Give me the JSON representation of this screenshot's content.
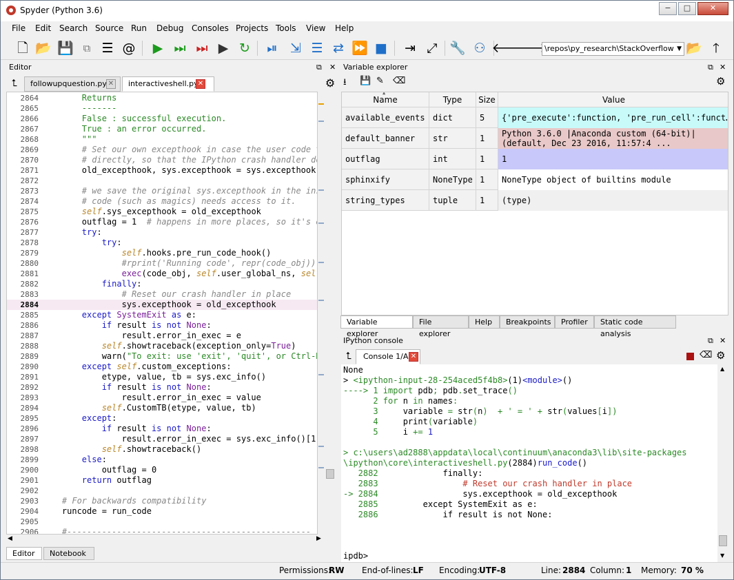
{
  "window": {
    "title": "Spyder (Python 3.6)",
    "min": "−",
    "max": "□",
    "close": "✕"
  },
  "menu": [
    "File",
    "Edit",
    "Search",
    "Source",
    "Run",
    "Debug",
    "Consoles",
    "Projects",
    "Tools",
    "View",
    "Help"
  ],
  "toolbar": {
    "path": "\\repos\\py_research\\StackOverflow",
    "dropdown": "▼"
  },
  "editor": {
    "title": "Editor",
    "tabs": [
      {
        "label": "followupquestion.py*"
      },
      {
        "label": "interactiveshell.py"
      }
    ],
    "bottom_tabs": [
      "Editor",
      "Notebook"
    ],
    "lines": [
      {
        "n": "2864",
        "segs": [
          {
            "t": "        "
          },
          {
            "t": "Returns",
            "c": "s"
          }
        ]
      },
      {
        "n": "2865",
        "segs": [
          {
            "t": "        "
          },
          {
            "t": "-------",
            "c": "s"
          }
        ]
      },
      {
        "n": "2866",
        "segs": [
          {
            "t": "        "
          },
          {
            "t": "False : successful execution.",
            "c": "s"
          }
        ]
      },
      {
        "n": "2867",
        "segs": [
          {
            "t": "        "
          },
          {
            "t": "True : an error occurred.",
            "c": "s"
          }
        ]
      },
      {
        "n": "2868",
        "segs": [
          {
            "t": "        "
          },
          {
            "t": "\"\"\"",
            "c": "s"
          }
        ]
      },
      {
        "n": "2869",
        "segs": [
          {
            "t": "        "
          },
          {
            "t": "# Set our own excepthook in case the user code tr",
            "c": "c"
          }
        ]
      },
      {
        "n": "2870",
        "segs": [
          {
            "t": "        "
          },
          {
            "t": "# directly, so that the IPython crash handler doe",
            "c": "c"
          }
        ]
      },
      {
        "n": "2871",
        "segs": [
          {
            "t": "        old_excepthook, sys.excepthook = sys.excepthook,"
          }
        ]
      },
      {
        "n": "2872",
        "segs": []
      },
      {
        "n": "2873",
        "segs": [
          {
            "t": "        "
          },
          {
            "t": "# we save the original sys.excepthook in the inst",
            "c": "c"
          }
        ]
      },
      {
        "n": "2874",
        "segs": [
          {
            "t": "        "
          },
          {
            "t": "# code (such as magics) needs access to it.",
            "c": "c"
          }
        ]
      },
      {
        "n": "2875",
        "segs": [
          {
            "t": "        "
          },
          {
            "t": "self",
            "c": "n"
          },
          {
            "t": ".sys_excepthook = old_excepthook"
          }
        ]
      },
      {
        "n": "2876",
        "segs": [
          {
            "t": "        outflag = 1  "
          },
          {
            "t": "# happens in more places, so it's ea",
            "c": "c"
          }
        ]
      },
      {
        "n": "2877",
        "segs": [
          {
            "t": "        "
          },
          {
            "t": "try",
            "c": "k"
          },
          {
            "t": ":"
          }
        ]
      },
      {
        "n": "2878",
        "segs": [
          {
            "t": "            "
          },
          {
            "t": "try",
            "c": "k"
          },
          {
            "t": ":"
          }
        ]
      },
      {
        "n": "2879",
        "segs": [
          {
            "t": "                "
          },
          {
            "t": "self",
            "c": "n"
          },
          {
            "t": ".hooks.pre_run_code_hook()"
          }
        ]
      },
      {
        "n": "2880",
        "segs": [
          {
            "t": "                "
          },
          {
            "t": "#rprint('Running code', repr(code_obj)) #",
            "c": "c"
          }
        ]
      },
      {
        "n": "2881",
        "segs": [
          {
            "t": "                "
          },
          {
            "t": "exec",
            "c": "p"
          },
          {
            "t": "(code_obj, "
          },
          {
            "t": "self",
            "c": "n"
          },
          {
            "t": ".user_global_ns, "
          },
          {
            "t": "self",
            "c": "n"
          },
          {
            "t": "."
          }
        ]
      },
      {
        "n": "2882",
        "segs": [
          {
            "t": "            "
          },
          {
            "t": "finally",
            "c": "k"
          },
          {
            "t": ":"
          }
        ]
      },
      {
        "n": "2883",
        "segs": [
          {
            "t": "                "
          },
          {
            "t": "# Reset our crash handler in place",
            "c": "c"
          }
        ]
      },
      {
        "n": "2884",
        "cur": true,
        "segs": [
          {
            "t": "                sys.excepthook = old_excepthook"
          }
        ]
      },
      {
        "n": "2885",
        "segs": [
          {
            "t": "        "
          },
          {
            "t": "except",
            "c": "k"
          },
          {
            "t": " "
          },
          {
            "t": "SystemExit",
            "c": "p"
          },
          {
            "t": " "
          },
          {
            "t": "as",
            "c": "k"
          },
          {
            "t": " e:"
          }
        ]
      },
      {
        "n": "2886",
        "segs": [
          {
            "t": "            "
          },
          {
            "t": "if",
            "c": "k"
          },
          {
            "t": " result "
          },
          {
            "t": "is not",
            "c": "k"
          },
          {
            "t": " "
          },
          {
            "t": "None",
            "c": "p"
          },
          {
            "t": ":"
          }
        ]
      },
      {
        "n": "2887",
        "segs": [
          {
            "t": "                result.error_in_exec = e"
          }
        ]
      },
      {
        "n": "2888",
        "segs": [
          {
            "t": "            "
          },
          {
            "t": "self",
            "c": "n"
          },
          {
            "t": ".showtraceback(exception_only="
          },
          {
            "t": "True",
            "c": "p"
          },
          {
            "t": ")"
          }
        ]
      },
      {
        "n": "2889",
        "segs": [
          {
            "t": "            warn("
          },
          {
            "t": "\"To exit: use 'exit', 'quit', or Ctrl-D.",
            "c": "s"
          }
        ]
      },
      {
        "n": "2890",
        "segs": [
          {
            "t": "        "
          },
          {
            "t": "except",
            "c": "k"
          },
          {
            "t": " "
          },
          {
            "t": "self",
            "c": "n"
          },
          {
            "t": ".custom_exceptions:"
          }
        ]
      },
      {
        "n": "2891",
        "segs": [
          {
            "t": "            etype, value, tb = sys.exc_info()"
          }
        ]
      },
      {
        "n": "2892",
        "segs": [
          {
            "t": "            "
          },
          {
            "t": "if",
            "c": "k"
          },
          {
            "t": " result "
          },
          {
            "t": "is not",
            "c": "k"
          },
          {
            "t": " "
          },
          {
            "t": "None",
            "c": "p"
          },
          {
            "t": ":"
          }
        ]
      },
      {
        "n": "2893",
        "segs": [
          {
            "t": "                result.error_in_exec = value"
          }
        ]
      },
      {
        "n": "2894",
        "segs": [
          {
            "t": "            "
          },
          {
            "t": "self",
            "c": "n"
          },
          {
            "t": ".CustomTB(etype, value, tb)"
          }
        ]
      },
      {
        "n": "2895",
        "segs": [
          {
            "t": "        "
          },
          {
            "t": "except",
            "c": "k"
          },
          {
            "t": ":"
          }
        ]
      },
      {
        "n": "2896",
        "segs": [
          {
            "t": "            "
          },
          {
            "t": "if",
            "c": "k"
          },
          {
            "t": " result "
          },
          {
            "t": "is not",
            "c": "k"
          },
          {
            "t": " "
          },
          {
            "t": "None",
            "c": "p"
          },
          {
            "t": ":"
          }
        ]
      },
      {
        "n": "2897",
        "segs": [
          {
            "t": "                result.error_in_exec = sys.exc_info()[1]"
          }
        ]
      },
      {
        "n": "2898",
        "segs": [
          {
            "t": "            "
          },
          {
            "t": "self",
            "c": "n"
          },
          {
            "t": ".showtraceback()"
          }
        ]
      },
      {
        "n": "2899",
        "segs": [
          {
            "t": "        "
          },
          {
            "t": "else",
            "c": "k"
          },
          {
            "t": ":"
          }
        ]
      },
      {
        "n": "2900",
        "segs": [
          {
            "t": "            outflag = 0"
          }
        ]
      },
      {
        "n": "2901",
        "segs": [
          {
            "t": "        "
          },
          {
            "t": "return",
            "c": "k"
          },
          {
            "t": " outflag"
          }
        ]
      },
      {
        "n": "2902",
        "segs": []
      },
      {
        "n": "2903",
        "segs": [
          {
            "t": "    "
          },
          {
            "t": "# For backwards compatibility",
            "c": "c"
          }
        ]
      },
      {
        "n": "2904",
        "segs": [
          {
            "t": "    runcode = run_code"
          }
        ]
      },
      {
        "n": "2905",
        "segs": []
      },
      {
        "n": "2906",
        "segs": [
          {
            "t": "    "
          },
          {
            "t": "#-------------------------------------------------",
            "c": "c"
          }
        ]
      }
    ]
  },
  "variable_explorer": {
    "title": "Variable explorer",
    "columns": [
      "Name",
      "Type",
      "Size",
      "Value"
    ],
    "rows": [
      {
        "name": "available_events",
        "type": "dict",
        "size": "5",
        "value": "{'pre_execute':function, 'pre_run_cell':funct…",
        "bg": "#c8fafa"
      },
      {
        "name": "default_banner",
        "type": "str",
        "size": "1",
        "value": "Python 3.6.0 |Anaconda custom (64-bit)|\n(default, Dec 23 2016, 11:57:4 ...",
        "bg": "#e8c8c8"
      },
      {
        "name": "outflag",
        "type": "int",
        "size": "1",
        "value": "1",
        "bg": "#c8c8fa"
      },
      {
        "name": "sphinxify",
        "type": "NoneType",
        "size": "1",
        "value": "NoneType object of builtins module",
        "bg": "#ffffff"
      },
      {
        "name": "string_types",
        "type": "tuple",
        "size": "1",
        "value": "(type)",
        "bg": "#f0f0f0"
      }
    ],
    "bottom_tabs": [
      "Variable explorer",
      "File explorer",
      "Help",
      "Breakpoints",
      "Profiler",
      "Static code analysis"
    ]
  },
  "console": {
    "title": "IPython console",
    "tab": "Console 1/A",
    "lines": [
      [
        {
          "t": "None"
        }
      ],
      [
        {
          "t": "> ",
          "c": "blk"
        },
        {
          "t": "<ipython-input-28-254aced5f4b8>",
          "c": "g"
        },
        {
          "t": "(1)"
        },
        {
          "t": "<module>",
          "c": "gb"
        },
        {
          "t": "()"
        }
      ],
      [
        {
          "t": "----> 1 ",
          "c": "g"
        },
        {
          "t": "import",
          "c": "g"
        },
        {
          "t": " pdb"
        },
        {
          "t": ";",
          "c": "g"
        },
        {
          "t": " pdb"
        },
        {
          "t": ".",
          "c": "g"
        },
        {
          "t": "set_trace"
        },
        {
          "t": "()",
          "c": "g"
        }
      ],
      [
        {
          "t": "      2 ",
          "c": "g"
        },
        {
          "t": "for",
          "c": "g"
        },
        {
          "t": " n "
        },
        {
          "t": "in",
          "c": "g"
        },
        {
          "t": " names"
        },
        {
          "t": ":",
          "c": "g"
        }
      ],
      [
        {
          "t": "      3 ",
          "c": "g"
        },
        {
          "t": "    variable "
        },
        {
          "t": "=",
          "c": "g"
        },
        {
          "t": " str"
        },
        {
          "t": "(",
          "c": "g"
        },
        {
          "t": "n"
        },
        {
          "t": ")",
          "c": "g"
        },
        {
          "t": "  + ' = ' + ",
          "c": "g"
        },
        {
          "t": "str"
        },
        {
          "t": "(",
          "c": "g"
        },
        {
          "t": "values"
        },
        {
          "t": "[",
          "c": "g"
        },
        {
          "t": "i"
        },
        {
          "t": "])",
          "c": "g"
        }
      ],
      [
        {
          "t": "      4 ",
          "c": "g"
        },
        {
          "t": "    print"
        },
        {
          "t": "(",
          "c": "g"
        },
        {
          "t": "variable"
        },
        {
          "t": ")",
          "c": "g"
        }
      ],
      [
        {
          "t": "      5 ",
          "c": "g"
        },
        {
          "t": "    i "
        },
        {
          "t": "+=",
          "c": "g"
        },
        {
          "t": " 1",
          "c": "gb"
        }
      ],
      [],
      [
        {
          "t": "> c:\\users\\ad2888\\appdata\\local\\continuum\\anaconda3\\lib\\site-packages",
          "c": "g"
        }
      ],
      [
        {
          "t": "\\ipython\\core\\interactiveshell.py",
          "c": "g"
        },
        {
          "t": "(2884)"
        },
        {
          "t": "run_code",
          "c": "gb"
        },
        {
          "t": "()"
        }
      ],
      [
        {
          "t": "   2882 ",
          "c": "g"
        },
        {
          "t": "            finally:"
        }
      ],
      [
        {
          "t": "   2883 ",
          "c": "g"
        },
        {
          "t": "                # Reset our crash handler in place",
          "c": "r"
        }
      ],
      [
        {
          "t": "-> 2884 ",
          "c": "g"
        },
        {
          "t": "                sys.excepthook = old_excepthook"
        }
      ],
      [
        {
          "t": "   2885 ",
          "c": "g"
        },
        {
          "t": "        except SystemExit as e:"
        }
      ],
      [
        {
          "t": "   2886 ",
          "c": "g"
        },
        {
          "t": "            if result is not None:"
        }
      ],
      [],
      [],
      [],
      [
        {
          "t": "ipdb>"
        }
      ],
      [
        {
          "t": "ipdb>"
        }
      ]
    ]
  },
  "status": {
    "permissions_label": "Permissions:",
    "permissions": "RW",
    "eol_label": "End-of-lines:",
    "eol": "LF",
    "encoding_label": "Encoding:",
    "encoding": "UTF-8",
    "line_label": "Line:",
    "line": "2884",
    "column_label": "Column:",
    "column": "1",
    "memory_label": "Memory:",
    "memory": "70 %"
  }
}
